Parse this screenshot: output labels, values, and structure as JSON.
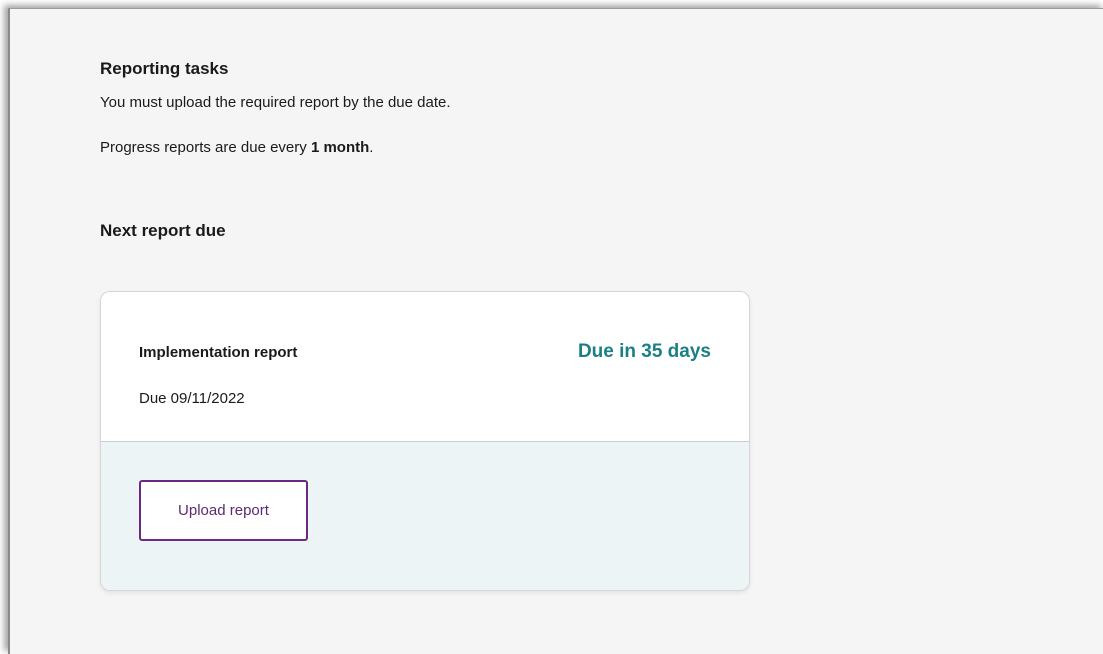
{
  "reporting": {
    "title": "Reporting tasks",
    "instruction": "You must upload the required report by the due date.",
    "frequency_prefix": "Progress reports are due every ",
    "frequency_value": "1 month",
    "frequency_suffix": "."
  },
  "next_report": {
    "title": "Next report due",
    "card": {
      "report_name": "Implementation report",
      "due_status": "Due in 35 days",
      "due_date": "Due 09/11/2022",
      "upload_label": "Upload report"
    }
  },
  "colors": {
    "accent_teal": "#1c7f86",
    "button_purple": "#6b2a82",
    "card_footer_bg": "#ecf4f5",
    "page_bg": "#f5f5f5"
  }
}
